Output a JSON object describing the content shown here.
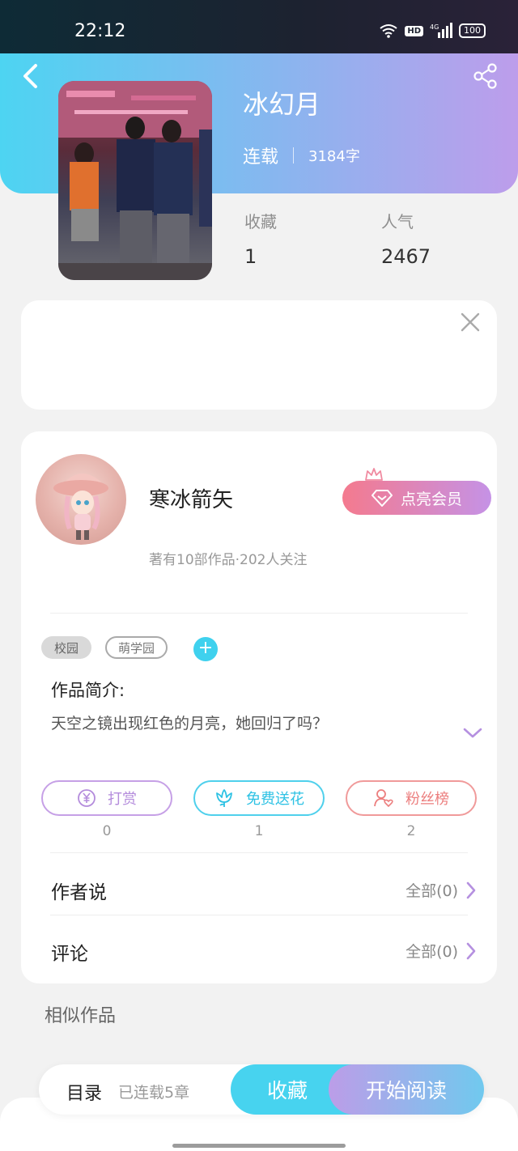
{
  "status_bar": {
    "time": "22:12",
    "hd": "HD",
    "network": "4G",
    "battery": "100"
  },
  "book": {
    "title": "冰幻月",
    "status": "连载",
    "word_count": "3184字"
  },
  "stats": [
    {
      "label": "收藏",
      "value": "1"
    },
    {
      "label": "人气",
      "value": "2467"
    }
  ],
  "author": {
    "name": "寒冰箭矢",
    "info": "著有10部作品·202人关注",
    "vip_label": "点亮会员"
  },
  "tags": [
    "校园",
    "萌学园"
  ],
  "intro": {
    "title": "作品简介:",
    "text": "天空之镜出现红色的月亮，她回归了吗？"
  },
  "actions": [
    {
      "label": "打赏",
      "count": "0"
    },
    {
      "label": "免费送花",
      "count": "1"
    },
    {
      "label": "粉丝榜",
      "count": "2"
    }
  ],
  "rows": [
    {
      "title": "作者说",
      "link": "全部(0)"
    },
    {
      "title": "评论",
      "link": "全部(0)"
    }
  ],
  "similar_title": "相似作品",
  "bottom_bar": {
    "toc": "目录",
    "chapters": "已连载5章",
    "bookshelf": "收藏",
    "read": "开始阅读"
  },
  "colors": {
    "accent_cyan": "#47d3ef",
    "accent_purple": "#bd9deb",
    "vip_pink": "#f47a8e"
  }
}
